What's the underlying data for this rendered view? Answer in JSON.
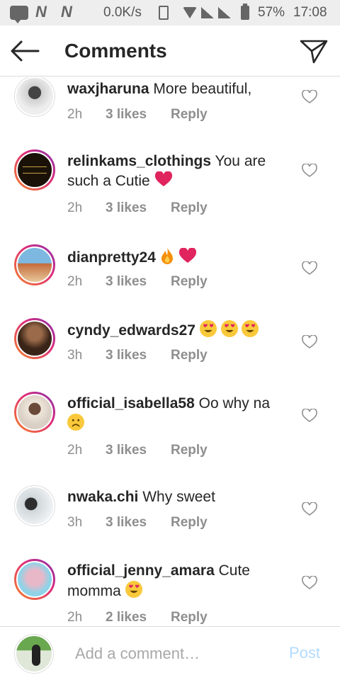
{
  "status_bar": {
    "network_speed": "0.0K/s",
    "battery": "57%",
    "time": "17:08",
    "n_label": "N",
    "icons": [
      "chat-icon",
      "n-notification-icon",
      "vibrate-icon",
      "wifi-icon",
      "signal-icon",
      "battery-icon"
    ]
  },
  "header": {
    "title": "Comments",
    "back_icon": "arrow-left-icon",
    "share_icon": "paper-plane-icon"
  },
  "reply_label": "Reply",
  "comments": [
    {
      "username": "waxjharuna",
      "text": "More beautiful,",
      "time": "2h",
      "likes": "3 likes",
      "avatar_colors": [
        "#2b2b2b",
        "#d8d8d8"
      ]
    },
    {
      "username": "relinkams_clothings",
      "text": "You are such a Cutie",
      "emoji": [
        "red-heart"
      ],
      "time": "2h",
      "likes": "3 likes",
      "avatar_colors": [
        "#1a1208",
        "#c9a24a"
      ]
    },
    {
      "username": "dianpretty24",
      "text": "",
      "emoji": [
        "fire",
        "red-heart"
      ],
      "time": "2h",
      "likes": "3 likes",
      "avatar_colors": [
        "#7db8e0",
        "#c46b3b"
      ]
    },
    {
      "username": "cyndy_edwards27",
      "text": "",
      "emoji": [
        "heart-eyes",
        "heart-eyes",
        "heart-eyes"
      ],
      "time": "3h",
      "likes": "3 likes",
      "avatar_colors": [
        "#3a2418",
        "#9a6a4a"
      ]
    },
    {
      "username": "official_isabella58",
      "text": "Oo why na",
      "emoji": [
        "frowning-face"
      ],
      "time": "2h",
      "likes": "3 likes",
      "avatar_colors": [
        "#d9cfc4",
        "#6b4a3a"
      ]
    },
    {
      "username": "nwaka.chi",
      "text": "Why sweet",
      "time": "3h",
      "likes": "3 likes",
      "avatar_colors": [
        "#cfd6da",
        "#2e2e2e"
      ]
    },
    {
      "username": "official_jenny_amara",
      "text": "Cute momma",
      "emoji": [
        "heart-eyes"
      ],
      "time": "2h",
      "likes": "2 likes",
      "avatar_colors": [
        "#8fd3e8",
        "#e9b8c8"
      ]
    }
  ],
  "composer": {
    "placeholder": "Add a comment…",
    "post_label": "Post",
    "avatar_colors": [
      "#6aa84f",
      "#222222"
    ]
  },
  "colors": {
    "text": "#262626",
    "meta": "#8e8e8e",
    "heart": "#e0245e",
    "post_disabled": "#b3dbff",
    "story_ring": [
      "#f58529",
      "#dd2a7b",
      "#8134af"
    ]
  }
}
